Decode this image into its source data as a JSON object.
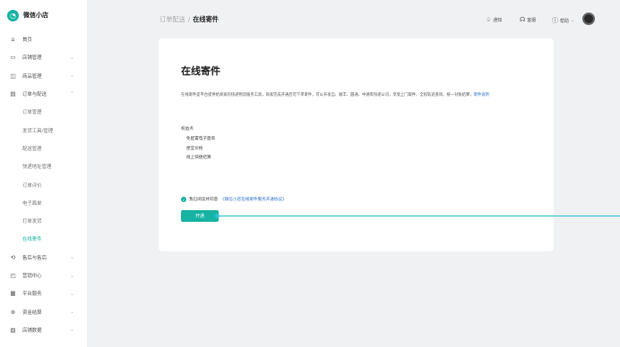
{
  "brand": {
    "name": "微信小店"
  },
  "sidebar": {
    "items": [
      {
        "label": "首页",
        "icon": "home-icon",
        "glyph": "⌂",
        "chevron": ""
      },
      {
        "label": "店铺管理",
        "icon": "store-icon",
        "glyph": "▭",
        "chevron": "⌄"
      },
      {
        "label": "商品管理",
        "icon": "bag-icon",
        "glyph": "◫",
        "chevron": "⌄"
      },
      {
        "label": "订单与配送",
        "icon": "order-icon",
        "glyph": "▤",
        "chevron": "⌃"
      }
    ],
    "subitems": [
      {
        "label": "订单管理"
      },
      {
        "label": "发货工具/管理"
      },
      {
        "label": "配送管理"
      },
      {
        "label": "快递地址管理"
      },
      {
        "label": "订单评价"
      },
      {
        "label": "电子面单"
      },
      {
        "label": "打单发货"
      },
      {
        "label": "在线寄件"
      }
    ],
    "bottom_items": [
      {
        "label": "售后与售后",
        "icon": "service-icon",
        "glyph": "⟲",
        "chevron": "⌄"
      },
      {
        "label": "营销中心",
        "icon": "marketing-icon",
        "glyph": "◰",
        "chevron": "⌄"
      },
      {
        "label": "平台服务",
        "icon": "platform-icon",
        "glyph": "▦",
        "chevron": "⌄"
      },
      {
        "label": "资金结算",
        "icon": "finance-icon",
        "glyph": "⊛",
        "chevron": "⌄"
      },
      {
        "label": "店铺数据",
        "icon": "data-icon",
        "glyph": "▨",
        "chevron": "⌄"
      }
    ]
  },
  "header": {
    "breadcrumb_parent": "订单配送",
    "breadcrumb_sep": "/",
    "breadcrumb_current": "在线寄件",
    "notify_label": "通知",
    "service_label": "客服",
    "help_label": "帮助"
  },
  "main": {
    "title": "在线寄件",
    "description": "在线寄件是平台提供给商家的快递物流服务工具，商家完成开通后可下单寄件，可以开发自、顺丰、圆通、中通等快递公司，享受上门取件、全程轨迹查询、统一对账结算，",
    "description_link": "寄件说明",
    "benefit_title": "权益点",
    "benefits": [
      "免配置电子面单",
      "便宜价格",
      "线上快捷结算"
    ],
    "agree_text": "我已阅读并同意",
    "agree_link": "《微信小店在线寄件服务开通协议》",
    "open_button": "开通"
  },
  "colors": {
    "accent": "#17b3a3",
    "link": "#2a70c8",
    "annotation": "#2fc0da"
  }
}
